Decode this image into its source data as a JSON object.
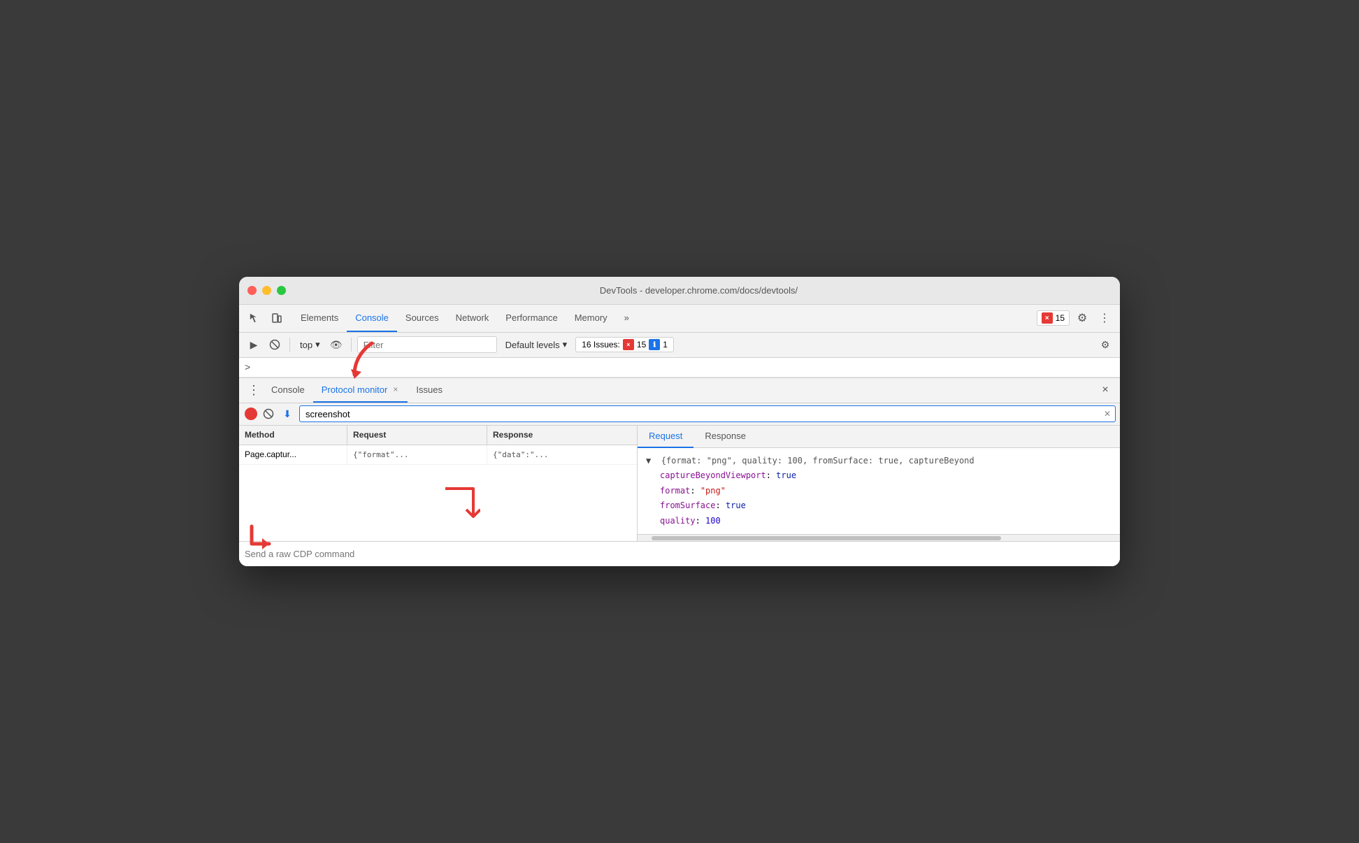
{
  "window": {
    "title": "DevTools - developer.chrome.com/docs/devtools/"
  },
  "tabs": {
    "items": [
      {
        "label": "Elements",
        "active": false
      },
      {
        "label": "Console",
        "active": true
      },
      {
        "label": "Sources",
        "active": false
      },
      {
        "label": "Network",
        "active": false
      },
      {
        "label": "Performance",
        "active": false
      },
      {
        "label": "Memory",
        "active": false
      }
    ],
    "more_label": "»"
  },
  "error_badge": {
    "count": "15",
    "icon_label": "×"
  },
  "console_toolbar": {
    "top_label": "top",
    "filter_placeholder": "Filter",
    "default_levels_label": "Default levels",
    "issues_label": "16 Issues:",
    "issues_error_count": "15",
    "issues_info_count": "1"
  },
  "breadcrumb": {
    "symbol": ">"
  },
  "drawer": {
    "tabs": [
      {
        "label": "Console",
        "active": false,
        "closeable": false
      },
      {
        "label": "Protocol monitor",
        "active": true,
        "closeable": true
      },
      {
        "label": "Issues",
        "active": false,
        "closeable": false
      }
    ],
    "close_label": "×"
  },
  "protocol_monitor": {
    "search_value": "screenshot",
    "table": {
      "headers": [
        "Method",
        "Request",
        "Response"
      ],
      "rows": [
        {
          "method": "Page.captur...",
          "request": "{\"format\"...",
          "response": "{\"data\":\"..."
        }
      ]
    },
    "detail_tabs": [
      "Request",
      "Response"
    ],
    "active_detail_tab": "Request",
    "detail_content": {
      "summary_line": "{format: \"png\", quality: 100, fromSurface: true, captureBeyond",
      "properties": [
        {
          "key": "captureBeyondViewport",
          "value": "true",
          "type": "bool"
        },
        {
          "key": "format",
          "value": "\"png\"",
          "type": "string"
        },
        {
          "key": "fromSurface",
          "value": "true",
          "type": "bool"
        },
        {
          "key": "quality",
          "value": "100",
          "type": "number"
        }
      ]
    }
  },
  "bottom_bar": {
    "placeholder": "Send a raw CDP command"
  },
  "icons": {
    "cursor": "⬚",
    "layers": "⧉",
    "run": "▶",
    "clear": "🚫",
    "download": "⬇",
    "eye": "👁",
    "gear": "⚙",
    "more_vert": "⋮",
    "chevron_down": "▾",
    "close": "✕"
  }
}
